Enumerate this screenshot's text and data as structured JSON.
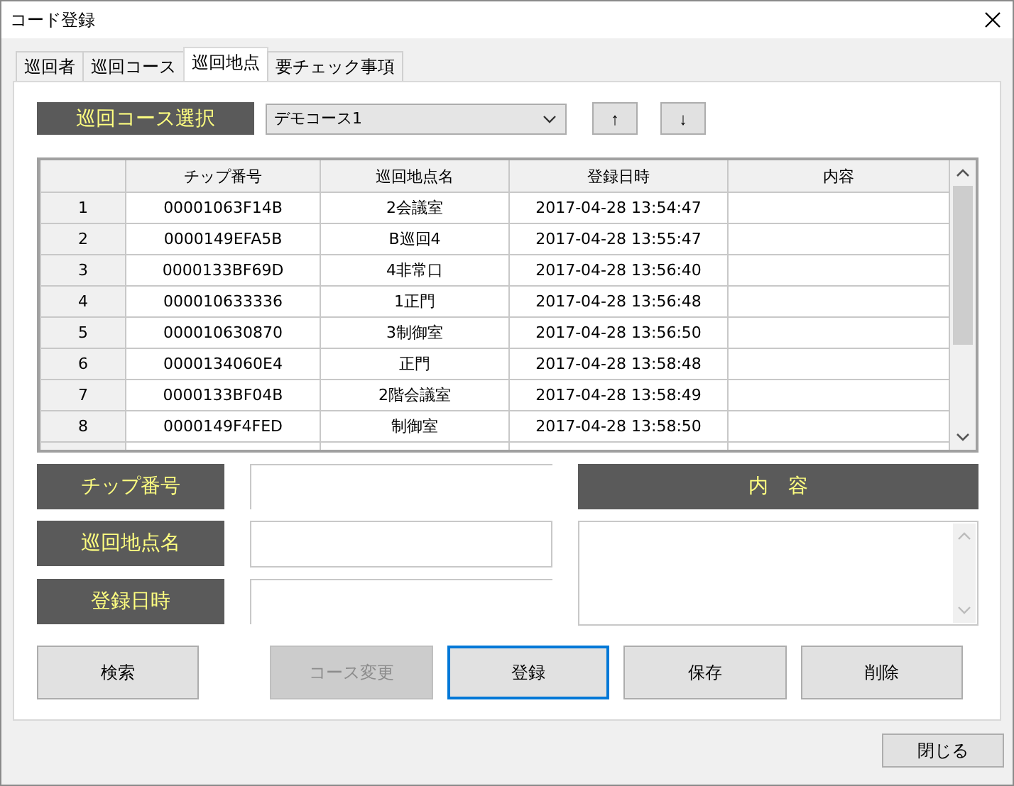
{
  "window": {
    "title": "コード登録"
  },
  "tabs": [
    {
      "label": "巡回者",
      "selected": false
    },
    {
      "label": "巡回コース",
      "selected": false
    },
    {
      "label": "巡回地点",
      "selected": true
    },
    {
      "label": "要チェック事項",
      "selected": false
    }
  ],
  "course_selector": {
    "label": "巡回コース選択",
    "value": "デモコース1"
  },
  "move_buttons": [
    "↑",
    "↓"
  ],
  "table": {
    "columns": [
      "チップ番号",
      "巡回地点名",
      "登録日時",
      "内容"
    ],
    "rows": [
      {
        "number": "1",
        "cells": [
          "00001063F14B",
          "2会議室",
          "2017-04-28 13:54:47",
          ""
        ]
      },
      {
        "number": "2",
        "cells": [
          "0000149EFA5B",
          "B巡回4",
          "2017-04-28 13:55:47",
          ""
        ]
      },
      {
        "number": "3",
        "cells": [
          "0000133BF69D",
          "4非常口",
          "2017-04-28 13:56:40",
          ""
        ]
      },
      {
        "number": "4",
        "cells": [
          "000010633336",
          "1正門",
          "2017-04-28 13:56:48",
          ""
        ]
      },
      {
        "number": "5",
        "cells": [
          "000010630870",
          "3制御室",
          "2017-04-28 13:56:50",
          ""
        ]
      },
      {
        "number": "6",
        "cells": [
          "0000134060E4",
          "正門",
          "2017-04-28 13:58:48",
          ""
        ]
      },
      {
        "number": "7",
        "cells": [
          "0000133BF04B",
          "2階会議室",
          "2017-04-28 13:58:49",
          ""
        ]
      },
      {
        "number": "8",
        "cells": [
          "0000149F4FED",
          "制御室",
          "2017-04-28 13:58:50",
          ""
        ]
      }
    ]
  },
  "fields": [
    {
      "label": "チップ番号"
    },
    {
      "label": "巡回地点名"
    },
    {
      "label": "登録日時"
    }
  ],
  "content": {
    "label": "内　容"
  },
  "actions": [
    {
      "label": "検索",
      "disabled": false,
      "focused": false
    },
    {
      "label": "コース変更",
      "disabled": true,
      "focused": false
    },
    {
      "label": "登録",
      "disabled": false,
      "focused": true
    },
    {
      "label": "保存",
      "disabled": false,
      "focused": false
    },
    {
      "label": "削除",
      "disabled": false,
      "focused": false
    }
  ],
  "close_button": "閉じる"
}
